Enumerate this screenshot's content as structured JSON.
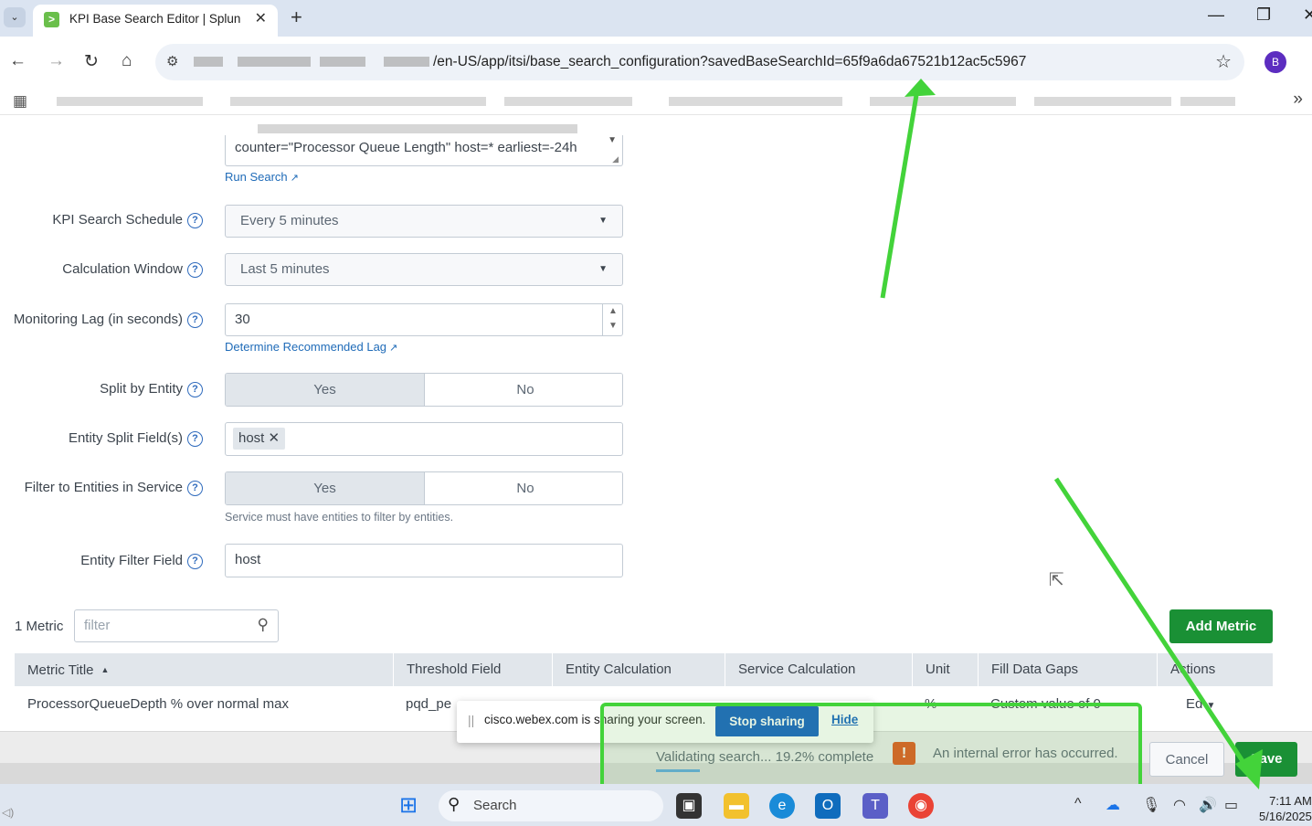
{
  "browser": {
    "tab_title": "KPI Base Search Editor | Splunk",
    "url_visible": "/en-US/app/itsi/base_search_configuration?savedBaseSearchId=65f9a6da67521b12ac5c5967",
    "profile_initial": "B"
  },
  "form": {
    "search_text": "counter=\"Processor Queue Length\" host=* earliest=-24h",
    "run_search_label": "Run Search",
    "schedule": {
      "label": "KPI Search Schedule",
      "value": "Every 5 minutes"
    },
    "calc_window": {
      "label": "Calculation Window",
      "value": "Last 5 minutes"
    },
    "monitoring_lag": {
      "label": "Monitoring Lag (in seconds)",
      "value": "30",
      "link": "Determine Recommended Lag"
    },
    "split_by_entity": {
      "label": "Split by Entity",
      "yes": "Yes",
      "no": "No",
      "selected": "Yes"
    },
    "entity_split_fields": {
      "label": "Entity Split Field(s)",
      "tags": [
        "host"
      ]
    },
    "filter_entities": {
      "label": "Filter to Entities in Service",
      "yes": "Yes",
      "no": "No",
      "selected": "Yes",
      "help": "Service must have entities to filter by entities."
    },
    "entity_filter_field": {
      "label": "Entity Filter Field",
      "value": "host"
    }
  },
  "metrics": {
    "count_label": "1 Metric",
    "filter_placeholder": "filter",
    "add_label": "Add Metric",
    "columns": [
      "Metric Title",
      "Threshold Field",
      "Entity Calculation",
      "Service Calculation",
      "Unit",
      "Fill Data Gaps",
      "Actions"
    ],
    "rows": [
      {
        "title": "ProcessorQueueDepth % over normal max",
        "threshold": "pqd_pe",
        "unit": "%",
        "fill": "Custom value of 0",
        "action": "Ed"
      }
    ]
  },
  "footer": {
    "cancel": "Cancel",
    "save": "Save",
    "validating": "Validating search... 19.2% complete",
    "validating_progress": 0.192,
    "error": "An internal error has occurred."
  },
  "webex": {
    "text": "cisco.webex.com is sharing your screen.",
    "stop": "Stop sharing",
    "hide": "Hide"
  },
  "taskbar": {
    "search": "Search",
    "time": "7:11 AM",
    "date": "5/16/2025"
  },
  "colors": {
    "accent_green": "#1a9035",
    "link_blue": "#1f6bb8",
    "annotation_green": "#43d33a",
    "error_orange": "#e0561b"
  }
}
